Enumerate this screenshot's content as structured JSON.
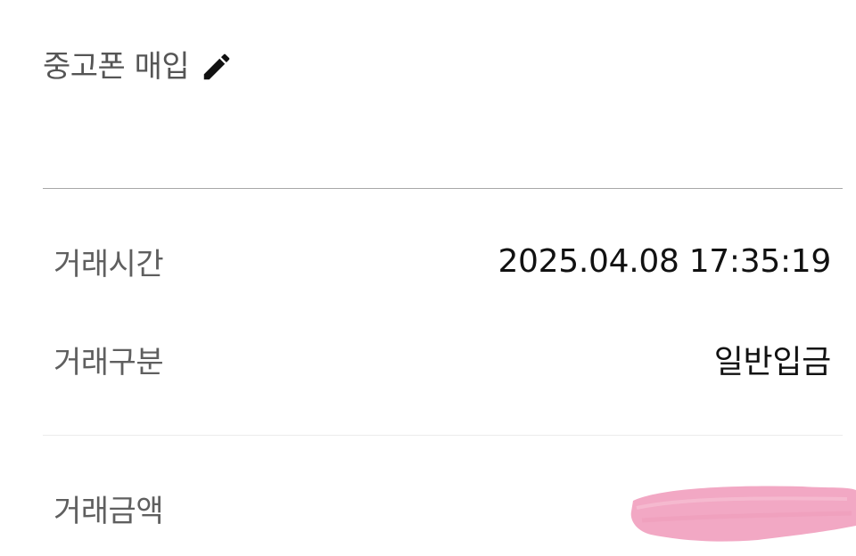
{
  "header": {
    "title": "중고폰 매입",
    "edit_icon": "pencil-icon"
  },
  "details": {
    "time": {
      "label": "거래시간",
      "value": "2025.04.08 17:35:19"
    },
    "type": {
      "label": "거래구분",
      "value": "일반입금"
    },
    "amount": {
      "label": "거래금액"
    }
  },
  "colors": {
    "redaction": "#f2a8c4",
    "divider": "#a8a8a8"
  }
}
